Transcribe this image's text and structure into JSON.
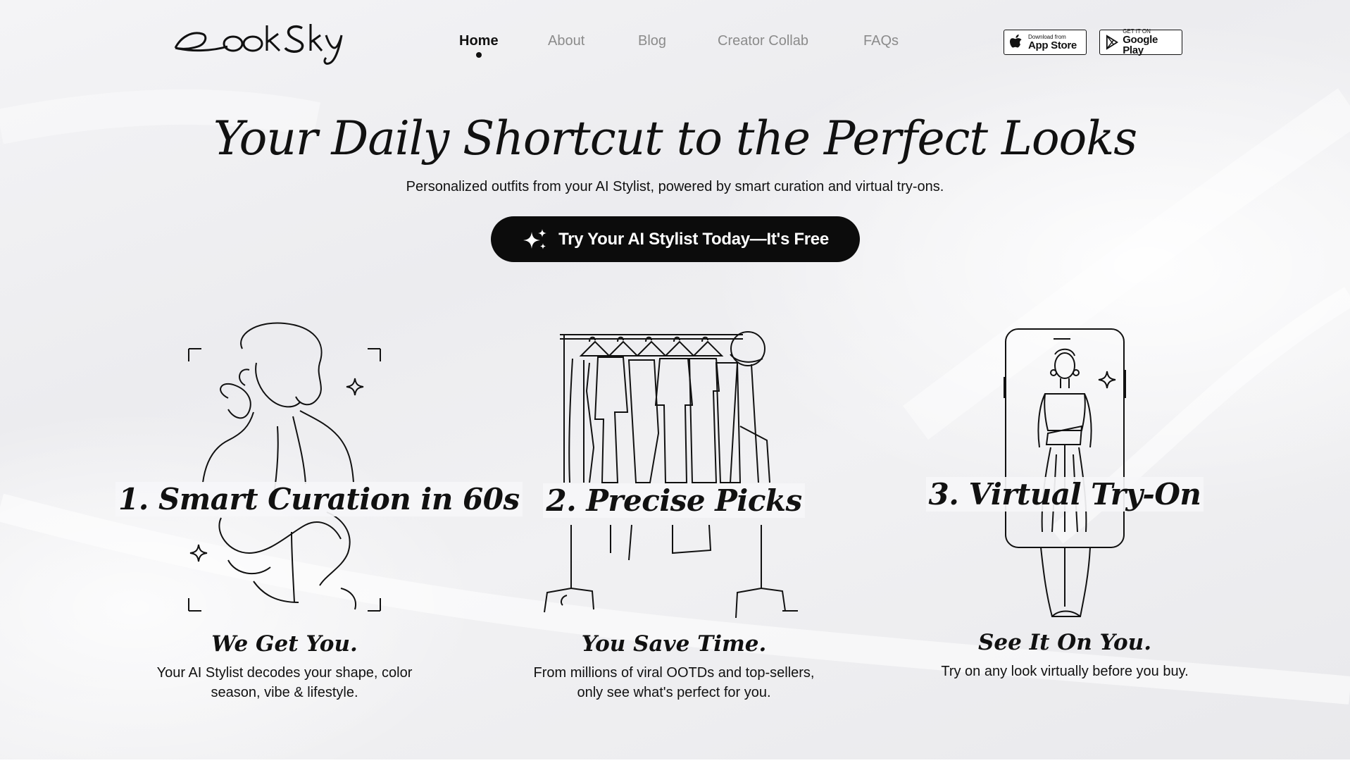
{
  "brand": {
    "logo_text": "LookSky"
  },
  "nav": {
    "items": [
      {
        "label": "Home",
        "active": true
      },
      {
        "label": "About",
        "active": false
      },
      {
        "label": "Blog",
        "active": false
      },
      {
        "label": "Creator Collab",
        "active": false
      },
      {
        "label": "FAQs",
        "active": false
      }
    ]
  },
  "stores": {
    "app_store": {
      "small": "Download from",
      "big": "App Store",
      "icon": "apple-icon"
    },
    "google_play": {
      "small": "GET IT ON",
      "big": "Google Play",
      "icon": "play-icon"
    }
  },
  "hero": {
    "title": "Your Daily Shortcut to the Perfect Looks",
    "subtitle": "Personalized outfits from your AI Stylist, powered by smart curation and virtual try-ons.",
    "cta_label": "Try Your AI Stylist Today—It's Free",
    "cta_icon": "sparkles-icon"
  },
  "features": [
    {
      "title": "1. Smart Curation in 60s",
      "tagline": "We Get You.",
      "description": "Your AI Stylist decodes your shape, color season, vibe & lifestyle.",
      "illustration": "woman-line-art"
    },
    {
      "title": "2. Precise Picks",
      "tagline": "You Save Time.",
      "description": "From millions of viral OOTDs and top-sellers, only see what's perfect for you.",
      "illustration": "clothing-rack-line-art"
    },
    {
      "title": "3. Virtual Try-On",
      "tagline": "See It On You.",
      "description": "Try on any look virtually before you buy.",
      "illustration": "phone-try-on-line-art"
    }
  ],
  "colors": {
    "ink": "#111111",
    "muted_nav": "#8b8b8b",
    "cta_bg": "#0c0c0c",
    "background": "#efeff1"
  }
}
